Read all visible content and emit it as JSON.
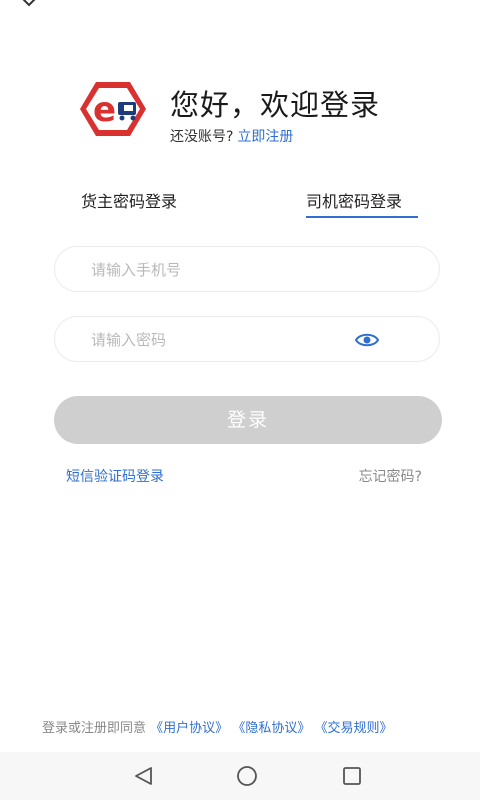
{
  "header": {
    "title": "您好，欢迎登录",
    "no_account_text": "还没账号?",
    "register_link": "立即注册"
  },
  "tabs": [
    {
      "label": "货主密码登录",
      "active": false
    },
    {
      "label": "司机密码登录",
      "active": true
    }
  ],
  "form": {
    "phone_placeholder": "请输入手机号",
    "phone_value": "",
    "password_placeholder": "请输入密码",
    "password_value": "",
    "password_toggle_icon": "eye-icon"
  },
  "actions": {
    "login_label": "登录",
    "sms_login_label": "短信验证码登录",
    "forgot_password_label": "忘记密码?"
  },
  "agreement": {
    "prefix": "登录或注册即同意",
    "user_agreement": "《用户协议》",
    "privacy_agreement": "《隐私协议》",
    "trade_rules": "《交易规则》"
  },
  "nav": {
    "back_icon": "triangle-back-icon",
    "home_icon": "circle-home-icon",
    "recent_icon": "square-recent-icon"
  },
  "colors": {
    "accent": "#2f6fd1",
    "logo_red": "#d9312f",
    "button_disabled": "#cfcfcf"
  }
}
